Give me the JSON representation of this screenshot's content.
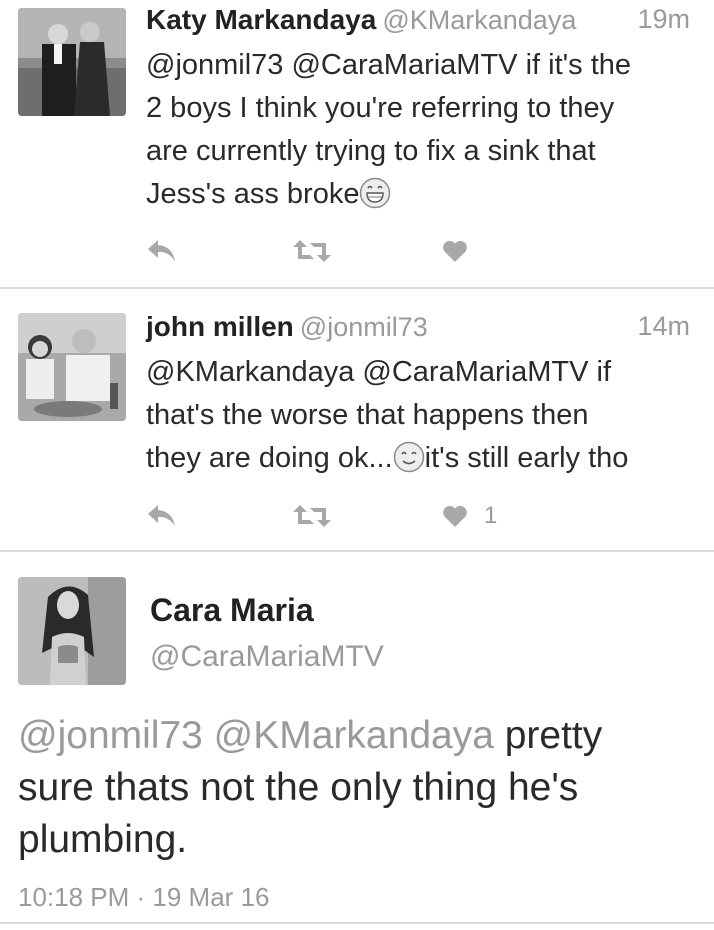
{
  "tweets": [
    {
      "name": "Katy Markandaya",
      "handle": "@KMarkandaya",
      "time": "19m",
      "lines": [
        "@jonmil73  @CaraMariaMTV if it's the",
        "2 boys I think you're referring to they",
        "are currently trying to fix a sink that",
        "Jess's ass broke"
      ],
      "avatar_icon": "couple-photo-avatar",
      "like_count": ""
    },
    {
      "name": "john millen",
      "handle": "@jonmil73",
      "time": "14m",
      "lines": [
        "@KMarkandaya @CaraMariaMTV if",
        "that's the worse that happens then",
        "they are doing ok...",
        "it's still early tho"
      ],
      "avatar_icon": "couple-dinner-avatar",
      "like_count": "1"
    }
  ],
  "main_tweet": {
    "name": "Cara Maria",
    "handle": "@CaraMariaMTV",
    "mentions": "@jonmil73 @KMarkandaya",
    "text_line1_rest": " pretty",
    "text_line2": "sure thats not the only thing he's",
    "text_line3": "plumbing.",
    "timestamp": "10:18 PM · 19 Mar 16",
    "avatar_icon": "woman-portrait-avatar"
  },
  "icons": [
    "reply-icon",
    "retweet-icon",
    "heart-icon",
    "grinning-emoji-icon",
    "smiling-emoji-icon"
  ],
  "colors": {
    "text": "#2a2a2a",
    "muted": "#9a9a9a",
    "divider": "#dcdcdc",
    "icon": "#a8a8a8"
  }
}
